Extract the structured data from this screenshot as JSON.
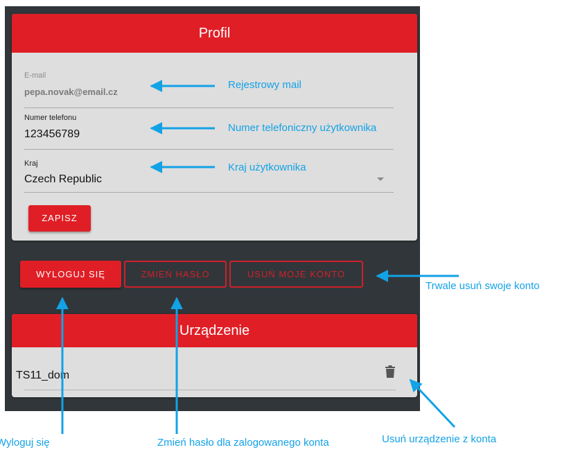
{
  "profile": {
    "title": "Profil",
    "email": {
      "label": "E-mail",
      "value": "pepa.novak@email.cz"
    },
    "phone": {
      "label": "Numer telefonu",
      "value": "123456789"
    },
    "country": {
      "label": "Kraj",
      "value": "Czech Republic"
    },
    "save_label": "ZAPISZ"
  },
  "actions": {
    "logout": "WYLOGUJ SIĘ",
    "change_password": "ZMIEŃ HASŁO",
    "delete_account": "USUŃ MOJE KONTO"
  },
  "device": {
    "title": "Urządzenie",
    "name": "TS11_dom"
  },
  "annotations": {
    "email": "Rejestrowy mail",
    "phone": "Numer telefoniczny użytkownika",
    "country": "Kraj użytkownika",
    "delete_account": "Trwale usuń swoje konto",
    "logout": "Wyloguj się",
    "change_password": "Zmień hasło dla zalogowanego konta",
    "remove_device": "Usuń urządzenie z konta"
  },
  "colors": {
    "accent": "#e01e26",
    "annotation": "#13a2e6",
    "background": "#31363a",
    "card": "#dedede"
  }
}
